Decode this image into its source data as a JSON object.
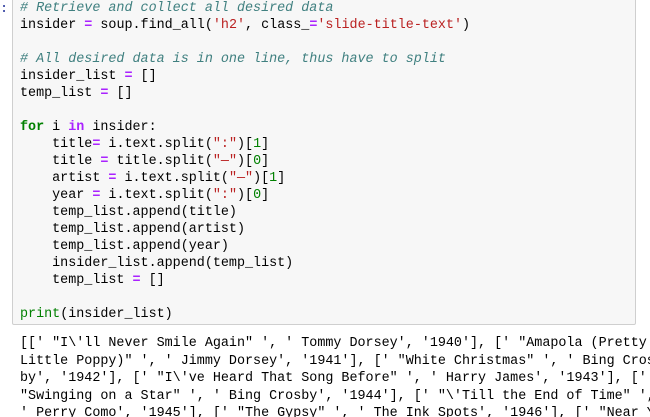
{
  "prompt_marker": ":",
  "code_lines": [
    [
      {
        "t": "# Retrieve and collect all desired data",
        "c": "cm"
      }
    ],
    [
      {
        "t": "insider ",
        "c": ""
      },
      {
        "t": "=",
        "c": "op"
      },
      {
        "t": " soup.find_all(",
        "c": ""
      },
      {
        "t": "'h2'",
        "c": "str"
      },
      {
        "t": ", class_",
        "c": ""
      },
      {
        "t": "=",
        "c": "op"
      },
      {
        "t": "'slide-title-text'",
        "c": "str"
      },
      {
        "t": ")",
        "c": ""
      }
    ],
    [
      {
        "t": "",
        "c": ""
      }
    ],
    [
      {
        "t": "# All desired data is in one line, thus have to split",
        "c": "cm"
      }
    ],
    [
      {
        "t": "insider_list ",
        "c": ""
      },
      {
        "t": "=",
        "c": "op"
      },
      {
        "t": " []",
        "c": ""
      }
    ],
    [
      {
        "t": "temp_list ",
        "c": ""
      },
      {
        "t": "=",
        "c": "op"
      },
      {
        "t": " []",
        "c": ""
      }
    ],
    [
      {
        "t": "",
        "c": ""
      }
    ],
    [
      {
        "t": "for",
        "c": "kw"
      },
      {
        "t": " i ",
        "c": ""
      },
      {
        "t": "in",
        "c": "op"
      },
      {
        "t": " insider:",
        "c": ""
      }
    ],
    [
      {
        "t": "    title",
        "c": ""
      },
      {
        "t": "=",
        "c": "op"
      },
      {
        "t": " i.text.split(",
        "c": ""
      },
      {
        "t": "\":\"",
        "c": "str"
      },
      {
        "t": ")[",
        "c": ""
      },
      {
        "t": "1",
        "c": "num"
      },
      {
        "t": "]",
        "c": ""
      }
    ],
    [
      {
        "t": "    title ",
        "c": ""
      },
      {
        "t": "=",
        "c": "op"
      },
      {
        "t": " title.split(",
        "c": ""
      },
      {
        "t": "\"—\"",
        "c": "str"
      },
      {
        "t": ")[",
        "c": ""
      },
      {
        "t": "0",
        "c": "num"
      },
      {
        "t": "]",
        "c": ""
      }
    ],
    [
      {
        "t": "    artist ",
        "c": ""
      },
      {
        "t": "=",
        "c": "op"
      },
      {
        "t": " i.text.split(",
        "c": ""
      },
      {
        "t": "\"—\"",
        "c": "str"
      },
      {
        "t": ")[",
        "c": ""
      },
      {
        "t": "1",
        "c": "num"
      },
      {
        "t": "]",
        "c": ""
      }
    ],
    [
      {
        "t": "    year ",
        "c": ""
      },
      {
        "t": "=",
        "c": "op"
      },
      {
        "t": " i.text.split(",
        "c": ""
      },
      {
        "t": "\":\"",
        "c": "str"
      },
      {
        "t": ")[",
        "c": ""
      },
      {
        "t": "0",
        "c": "num"
      },
      {
        "t": "]",
        "c": ""
      }
    ],
    [
      {
        "t": "    temp_list.append(title)",
        "c": ""
      }
    ],
    [
      {
        "t": "    temp_list.append(artist)",
        "c": ""
      }
    ],
    [
      {
        "t": "    temp_list.append(year)",
        "c": ""
      }
    ],
    [
      {
        "t": "    insider_list.append(temp_list)",
        "c": ""
      }
    ],
    [
      {
        "t": "    temp_list ",
        "c": ""
      },
      {
        "t": "=",
        "c": "op"
      },
      {
        "t": " []",
        "c": ""
      }
    ],
    [
      {
        "t": "",
        "c": ""
      }
    ],
    [
      {
        "t": "print",
        "c": "bi"
      },
      {
        "t": "(insider_list)",
        "c": ""
      }
    ]
  ],
  "output_lines": [
    "[[' \"I\\'ll Never Smile Again\" ', ' Tommy Dorsey', '1940'], [' \"Amapola (Pretty",
    "Little Poppy)\" ', ' Jimmy Dorsey', '1941'], [' \"White Christmas\" ', ' Bing Cros",
    "by', '1942'], [' \"I\\'ve Heard That Song Before\" ', ' Harry James', '1943'], ['",
    "\"Swinging on a Star\" ', ' Bing Crosby', '1944'], [' \"\\'Till the End of Time\" ',",
    "' Perry Como', '1945'], [' \"The Gypsy\" ', ' The Ink Spots', '1946'], [' \"Near Y"
  ]
}
